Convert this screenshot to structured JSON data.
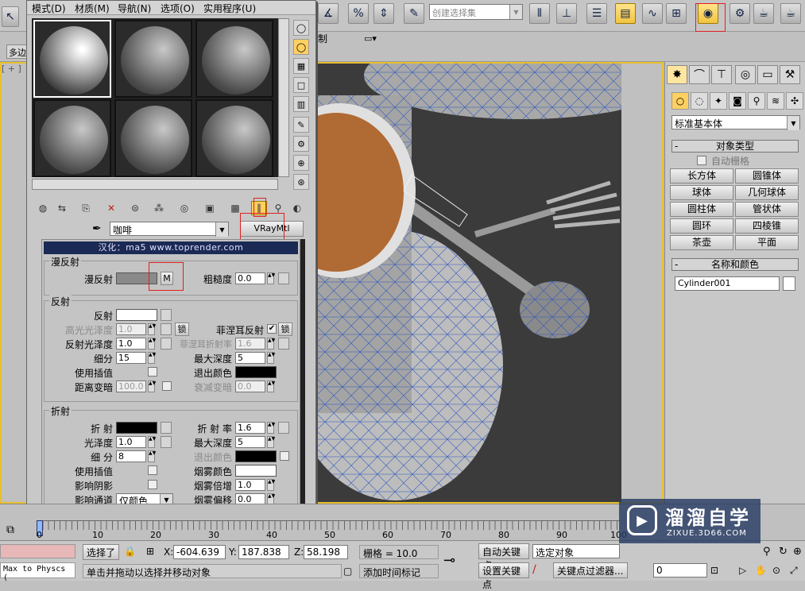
{
  "toolbar": {
    "selection_set_placeholder": "创建选择集",
    "viewport_menu_text": "制",
    "tab_label": "多边"
  },
  "viewport": {
    "label": "[ + ]"
  },
  "material_editor": {
    "menu": [
      "模式(D)",
      "材质(M)",
      "导航(N)",
      "选项(O)",
      "实用程序(U)"
    ],
    "material_name": "咖啡",
    "material_type": "VRayMtl",
    "banner": "汉化：ma5  www.toprender.com",
    "diffuse": {
      "title": "漫反射",
      "diffuse_label": "漫反射",
      "map_button": "M",
      "roughness_label": "粗糙度",
      "roughness_value": "0.0",
      "diffuse_color": "#8a8a8a"
    },
    "reflection": {
      "title": "反射",
      "reflect_label": "反射",
      "reflect_color": "#ffffff",
      "hilight_gloss_label": "高光光泽度",
      "hilight_gloss_value": "1.0",
      "lock_label": "锁",
      "fresnel_label": "菲涅耳反射",
      "fresnel_checked": "✔",
      "lock2_label": "锁",
      "refl_gloss_label": "反射光泽度",
      "refl_gloss_value": "1.0",
      "fresnel_ior_label": "菲涅耳折射率",
      "fresnel_ior_value": "1.6",
      "subdivs_label": "细分",
      "subdivs_value": "15",
      "max_depth_label": "最大深度",
      "max_depth_value": "5",
      "use_interp_label": "使用插值",
      "exit_color_label": "退出颜色",
      "exit_color": "#000000",
      "dim_distance_label": "距离变暗",
      "dim_distance_value": "100.0",
      "dim_falloff_label": "衰减变暗",
      "dim_falloff_value": "0.0"
    },
    "refraction": {
      "title": "折射",
      "refract_label": "折 射",
      "refract_color": "#000000",
      "ior_label": "折 射 率",
      "ior_value": "1.6",
      "gloss_label": "光泽度",
      "gloss_value": "1.0",
      "max_depth_label": "最大深度",
      "max_depth_value": "5",
      "subdivs_label": "细 分",
      "subdivs_value": "8",
      "exit_color_label": "退出颜色",
      "exit_color": "#000000",
      "use_interp_label": "使用插值",
      "fog_color_label": "烟雾颜色",
      "fog_color": "#ffffff",
      "affect_shadows_label": "影响阴影",
      "fog_mult_label": "烟雾倍增",
      "fog_mult_value": "1.0",
      "affect_channels_label": "影响通道",
      "affect_channels_value": "仅颜色",
      "fog_bias_label": "烟雾偏移",
      "fog_bias_value": "0.0"
    }
  },
  "command_panel": {
    "category": "标准基本体",
    "object_type_title": "对象类型",
    "autogrid_label": "自动栅格",
    "buttons": [
      "长方体",
      "圆锥体",
      "球体",
      "几何球体",
      "圆柱体",
      "管状体",
      "圆环",
      "四棱锥",
      "茶壶",
      "平面"
    ],
    "name_color_title": "名称和颜色",
    "object_name": "Cylinder001",
    "object_color": "#ffffff"
  },
  "timeline": {
    "ticks": [
      "0",
      "10",
      "20",
      "30",
      "40",
      "50",
      "60",
      "70",
      "80",
      "90",
      "100"
    ]
  },
  "status": {
    "maxscript": "Max to Physcs (",
    "selected_label": "选择了",
    "x_label": "X:",
    "x_value": "-604.639",
    "y_label": "Y:",
    "y_value": "187.838",
    "z_label": "Z:",
    "z_value": "58.198",
    "grid_text": "栅格 = 10.0",
    "auto_key": "自动关键点",
    "selected_object": "选定对象",
    "set_key": "设置关键点",
    "key_filters": "关键点过滤器...",
    "prompt": "单击并拖动以选择并移动对象",
    "add_time_tag": "添加时间标记",
    "frame_value": "0"
  },
  "watermark": {
    "brand": "溜溜自学",
    "url": "ZIXUE.3D66.COM"
  }
}
